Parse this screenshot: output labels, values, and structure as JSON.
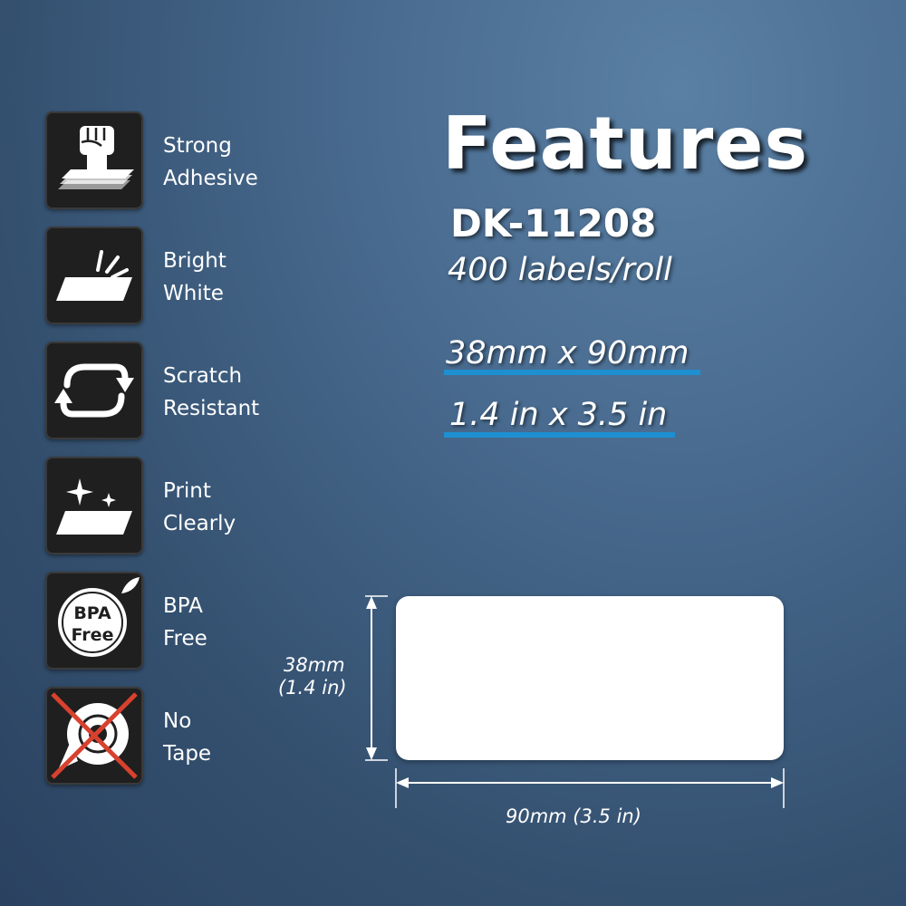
{
  "heading": {
    "title": "Features",
    "model": "DK-11208",
    "count": "400 labels/roll",
    "size_mm": "38mm x 90mm",
    "size_in": "1.4 in x 3.5 in"
  },
  "features": [
    {
      "icon": "fist-adhesive-icon",
      "line1": "Strong",
      "line2": "Adhesive"
    },
    {
      "icon": "bright-label-icon",
      "line1": "Bright",
      "line2": "White"
    },
    {
      "icon": "refresh-arrows-icon",
      "line1": "Scratch",
      "line2": "Resistant"
    },
    {
      "icon": "sparkle-label-icon",
      "line1": "Print",
      "line2": "Clearly"
    },
    {
      "icon": "bpa-free-icon",
      "line1": "BPA",
      "line2": "Free",
      "badge_line1": "BPA",
      "badge_line2": "Free"
    },
    {
      "icon": "no-tape-icon",
      "line1": "No",
      "line2": "Tape"
    }
  ],
  "diagram": {
    "height_mm": "38mm",
    "height_in": "(1.4 in)",
    "width_label": "90mm  (3.5 in)"
  },
  "colors": {
    "accent_underline": "#1e8fd0",
    "icon_tile": "#1f1f1f",
    "cross_red": "#d8412e"
  }
}
